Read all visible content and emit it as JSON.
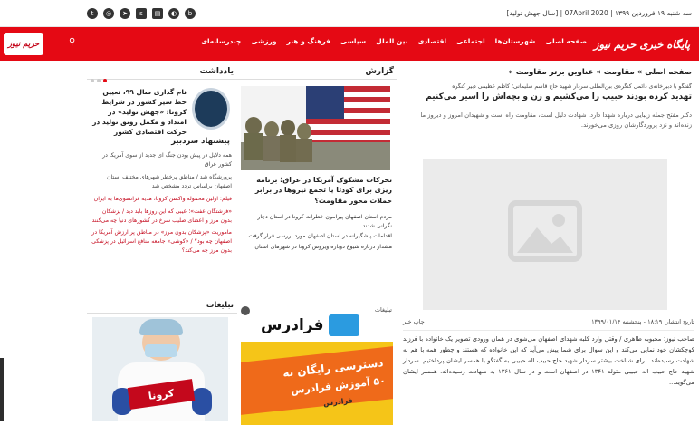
{
  "topbar": {
    "date": "سه شنبه ۱۹ فروردین ۱۳۹۹ | 07April 2020 | [سال جهش تولید]",
    "social": [
      "twitter",
      "instagram",
      "telegram",
      "sapp",
      "aparat",
      "soroush",
      "bale"
    ]
  },
  "nav": {
    "logo": "پایگاه خبری حریم نیوز",
    "items": [
      "صفحه اصلی",
      "شهرستان‌ها",
      "اجتماعی",
      "اقتصادی",
      "بین الملل",
      "سیاسی",
      "فرهنگ و هنر",
      "ورزشی",
      "چندرسانه‌ای"
    ],
    "small_logo": "حریم نیوز"
  },
  "main": {
    "breadcrumb": "صفحه اصلی » مقاومت » عناوین برتر مقاومت »",
    "subtitle": "گفتگو با دبیرخانه‌ی دائمی کنگره‌ی بین‌المللی سردار شهید حاج قاسم سلیمانی؛ کاظم عظیمی دبیر کنگره",
    "headline": "تهدید کرده بودند حبیب را می‌کشیم و زن و بچه‌اش را اسیر می‌کنیم",
    "lead": "دکتر مفتح جمله زیبایی درباره شهدا دارد. شهادت دلیل است، مقاومت راه است و شهیدان امروز و دیروز ما زنده‌اند و نزد پروردگارشان روزی می‌خورند.",
    "meta_date": "تاریخ انتشار: ۱۸:۱۹ - پنجشنبه ۱۳۹۹/۰۱/۱۴",
    "print": "چاپ خبر",
    "body": "صاحب نیوز: محبوبه طاهری / وقتی وارد کلبه شهدای اصفهان می‌شوی در همان ورودی تصویر یک خانواده با فرزند کوچکشان خود نمایی می‌کند و این سوال برای شما پیش می‌آید که این خانواده که هستند و چطور همه با هم به شهادت رسیده‌اند. برای شناخت بیشتر سردار شهید حاج حبیب اله حبیبی به گفتگو با همسر ایشان پرداختیم. سردار شهید حاج حبیب اله حبیبی متولد ۱۳۴۱ در اصفهان است و در سال ۱۳۶۱ به شهادت رسیده‌اند. همسر ایشان می‌گوید..."
  },
  "report": {
    "head": "گزارش",
    "title": "تحرکات مشکوک آمریکا در عراق؛ برنامه ریزی برای کودتا یا تجمع نیروها در برابر حملات محور مقاومت؟",
    "items": [
      "مردم استان اصفهان پیرامون خطرات کرونا در استان دچار نگرانی شدند",
      "اقدامات پیشگیرانه در استان اصفهان مورد بررسی قرار گرفت",
      "هشدار درباره شیوع دوباره ویروس کرونا در شهرهای استان"
    ]
  },
  "fardars": {
    "name": "فرادرس",
    "line1": "دسترسی رایگان به",
    "line2": "۵۰ آموزش فرادرس",
    "line3": "فرادرس",
    "tag": "تبلیغات"
  },
  "left": {
    "head": "یادداشت",
    "memo": "نام گذاری سال ۹۹، تعیین خط سیر کشور در شرایط کرونا؛ «جهش تولید» در امتداد و مکمل رونق تولید در حرکت اقتصادی کشور",
    "editor_head": "پیشنهاد سردبیر",
    "editor": [
      {
        "t": "همه دلایل در پیش بودن جنگ ای جدید از سوی آمریکا در کشور عراق",
        "red": false
      },
      {
        "t": "پرورشگاه شد / مناطق پرخطر شهرهای مختلف استان اصفهان براساس تردد مشخص شد",
        "red": false
      },
      {
        "t": "فیلم: اولین محموله واکسن کرونا، هدیه فرانسوی‌ها به ایران",
        "red": true
      },
      {
        "t": "«فرشتگان عفت»؛ عیبی که این روزها باید دید / پزشکان بدون مرز و اعضای صلیب سرخ در کشورهای دنیا چه می‌کنند",
        "red": true
      },
      {
        "t": "ماموریت «پزشکان بدون مرز» در مناطق پر ارزش آمریکا در اصفهان چه بود؟ / «کوشی» جامعه منافع اسرائیل در پزشکی بدون مرز چه می‌کند؟",
        "red": true
      }
    ],
    "ads_head": "تبلیغات",
    "corona": "کرونا"
  }
}
